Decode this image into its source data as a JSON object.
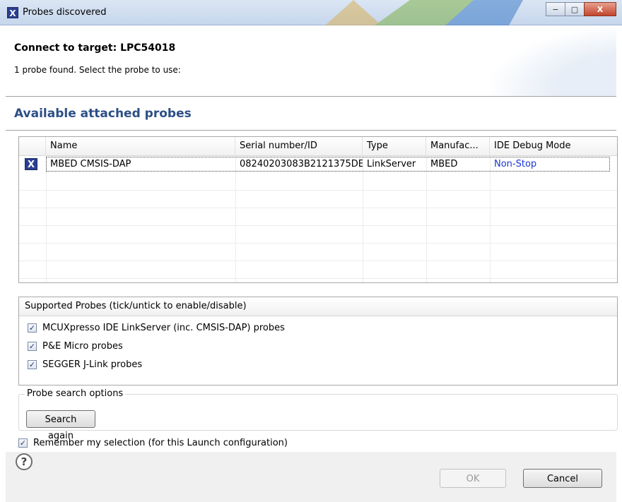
{
  "window": {
    "title": "Probes discovered",
    "app_icon": "X",
    "minimize": "−",
    "maximize": "▢",
    "close": "X"
  },
  "header": {
    "title": "Connect to target: LPC54018",
    "subtitle": "1 probe found. Select the probe to use:"
  },
  "section": {
    "title": "Available attached probes"
  },
  "table": {
    "columns": [
      "Name",
      "Serial number/ID",
      "Type",
      "Manufac...",
      "IDE Debug Mode"
    ],
    "rows": [
      {
        "icon": "X",
        "name": "MBED CMSIS-DAP",
        "serial": "08240203083B2121375DE",
        "type": "LinkServer",
        "manufacturer": "MBED",
        "mode": "Non-Stop"
      }
    ]
  },
  "supported": {
    "title": "Supported Probes (tick/untick to enable/disable)",
    "items": [
      {
        "label": "MCUXpresso IDE LinkServer (inc. CMSIS-DAP) probes",
        "checked": true
      },
      {
        "label": "P&E Micro probes",
        "checked": true
      },
      {
        "label": "SEGGER J-Link probes",
        "checked": true
      }
    ]
  },
  "search": {
    "legend": "Probe search options",
    "button": "Search again"
  },
  "remember": {
    "label": "Remember my selection (for this Launch configuration)",
    "checked": true
  },
  "footer": {
    "ok": "OK",
    "cancel": "Cancel",
    "help": "?"
  },
  "colors": {
    "section_title": "#2c4f86",
    "link": "#1a37d6"
  }
}
